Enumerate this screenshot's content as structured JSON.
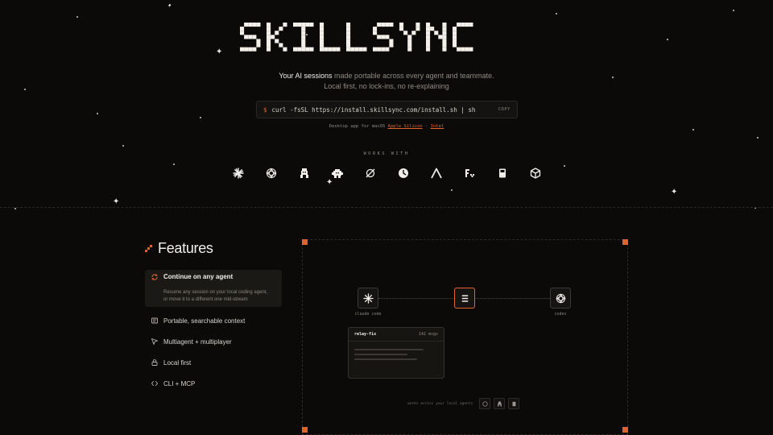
{
  "brand": {
    "name": "SKILLSYNC"
  },
  "hero": {
    "tagline_highlight": "Your AI sessions",
    "tagline_rest": " made portable across every agent and teammate.",
    "tagline_line2": "Local first, no lock-ins, no re-explaining"
  },
  "install": {
    "prompt": "$",
    "command": "curl -fsSL https://install.skillsync.com/install.sh | sh",
    "copy_label": "COPY"
  },
  "desktop": {
    "prefix": "Desktop app for macOS",
    "apple_silicon": "Apple Silicon",
    "separator": "·",
    "intel": "Intel"
  },
  "works_with": {
    "label": "WORKS WITH",
    "icons": [
      "claude-icon",
      "openai-icon",
      "gemini-icon",
      "android-icon",
      "planet-icon",
      "clock-icon",
      "lambda-icon",
      "fx-icon",
      "device-icon",
      "cube-icon"
    ]
  },
  "features": {
    "title": "Features",
    "items": [
      {
        "label": "Continue on any agent",
        "desc_line1": "Resume any session on your local coding agent,",
        "desc_line2": "or move it to a different one mid-stream",
        "icon": "sync-icon"
      },
      {
        "label": "Portable, searchable context",
        "icon": "context-icon"
      },
      {
        "label": "Multiagent + multiplayer",
        "icon": "cursor-icon"
      },
      {
        "label": "Local first",
        "icon": "lock-icon"
      },
      {
        "label": "CLI + MCP",
        "icon": "code-icon"
      }
    ]
  },
  "demo": {
    "left_node_label": "claude code",
    "right_node_label": "codex",
    "session_name": "relay-fix",
    "session_count": "142 msgs",
    "workflow_text": "works across your local agents"
  },
  "colors": {
    "accent": "#e0632e",
    "background": "#0b0a09",
    "panel": "#171512"
  }
}
